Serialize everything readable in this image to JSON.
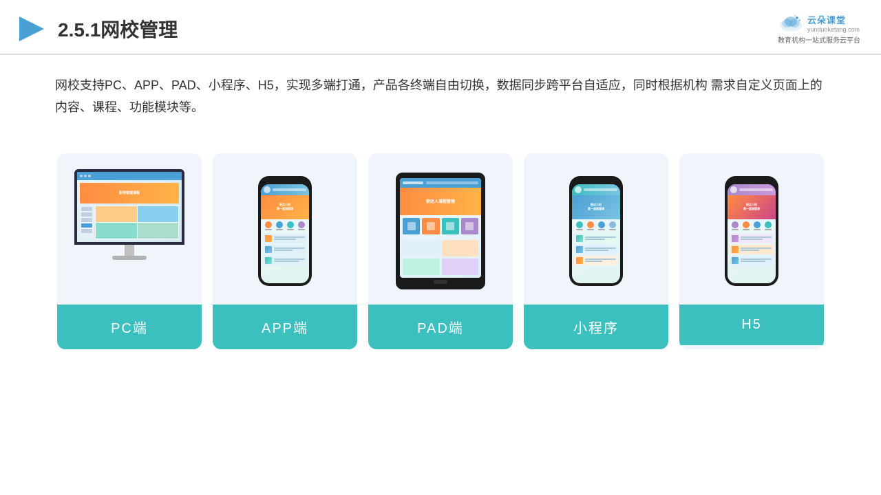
{
  "header": {
    "title": "2.5.1网校管理",
    "logo": {
      "name": "云朵课堂",
      "url": "yunduoketang.com",
      "tagline": "教育机构一站\n式服务云平台"
    }
  },
  "description": "网校支持PC、APP、PAD、小程序、H5，实现多端打通，产品各终端自由切换，数据同步跨平台自适应，同时根据机构\n需求自定义页面上的内容、课程、功能模块等。",
  "cards": [
    {
      "id": "pc",
      "label": "PC端"
    },
    {
      "id": "app",
      "label": "APP端"
    },
    {
      "id": "pad",
      "label": "PAD端"
    },
    {
      "id": "mini",
      "label": "小程序"
    },
    {
      "id": "h5",
      "label": "H5"
    }
  ],
  "accent_color": "#3cbfbf",
  "brand_color": "#4a9fd4"
}
